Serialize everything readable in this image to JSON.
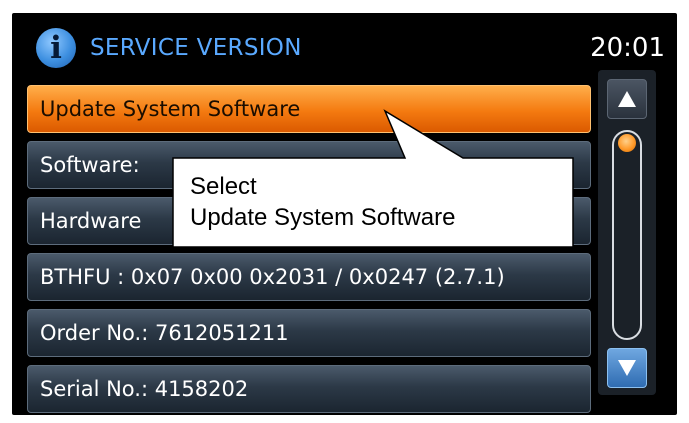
{
  "header": {
    "title": "SERVICE VERSION",
    "clock": "20:01",
    "icon": "info-icon",
    "icon_glyph": "i"
  },
  "menu": {
    "items": [
      {
        "label": "Update System Software",
        "selected": true
      },
      {
        "label": "Software:",
        "selected": false
      },
      {
        "label": "Hardware",
        "selected": false
      },
      {
        "label": "BTHFU : 0x07 0x00 0x2031 / 0x0247 (2.7.1)",
        "selected": false
      },
      {
        "label": "Order No.: 7612051211",
        "selected": false
      },
      {
        "label": "Serial No.: 4158202",
        "selected": false
      }
    ]
  },
  "scrollbar": {
    "up_icon": "triangle-up-icon",
    "down_icon": "triangle-down-icon",
    "position": 0
  },
  "callout": {
    "line1": "Select",
    "line2": "Update System Software"
  },
  "colors": {
    "selected_row": "#f47a10",
    "title_blue": "#5aa9ff",
    "screen_bg": "#000000"
  }
}
